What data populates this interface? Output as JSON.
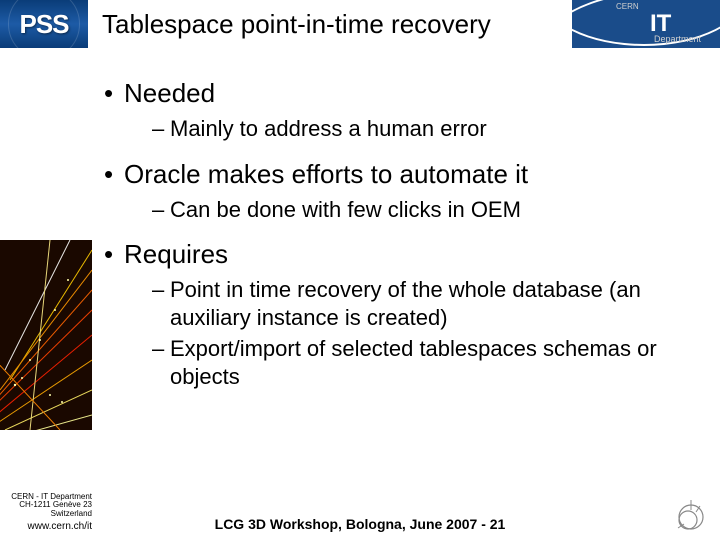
{
  "header": {
    "badge": "PSS",
    "title": "Tablespace point-in-time recovery",
    "logo_cern": "CERN",
    "logo_it": "IT",
    "logo_dept": "Department"
  },
  "bullets": [
    {
      "text": "Needed",
      "sub": [
        "Mainly to address a human error"
      ]
    },
    {
      "text": "Oracle makes efforts to automate it",
      "sub": [
        "Can be done with few clicks in OEM"
      ]
    },
    {
      "text": "Requires",
      "sub": [
        "Point in time recovery of the whole database (an auxiliary instance is created)",
        "Export/import of selected tablespaces schemas or objects"
      ]
    }
  ],
  "footer": {
    "line1": "CERN - IT Department",
    "line2": "CH-1211 Genève 23",
    "line3": "Switzerland",
    "url": "www.cern.ch/it",
    "center": "LCG 3D Workshop, Bologna, June 2007 - 21"
  }
}
